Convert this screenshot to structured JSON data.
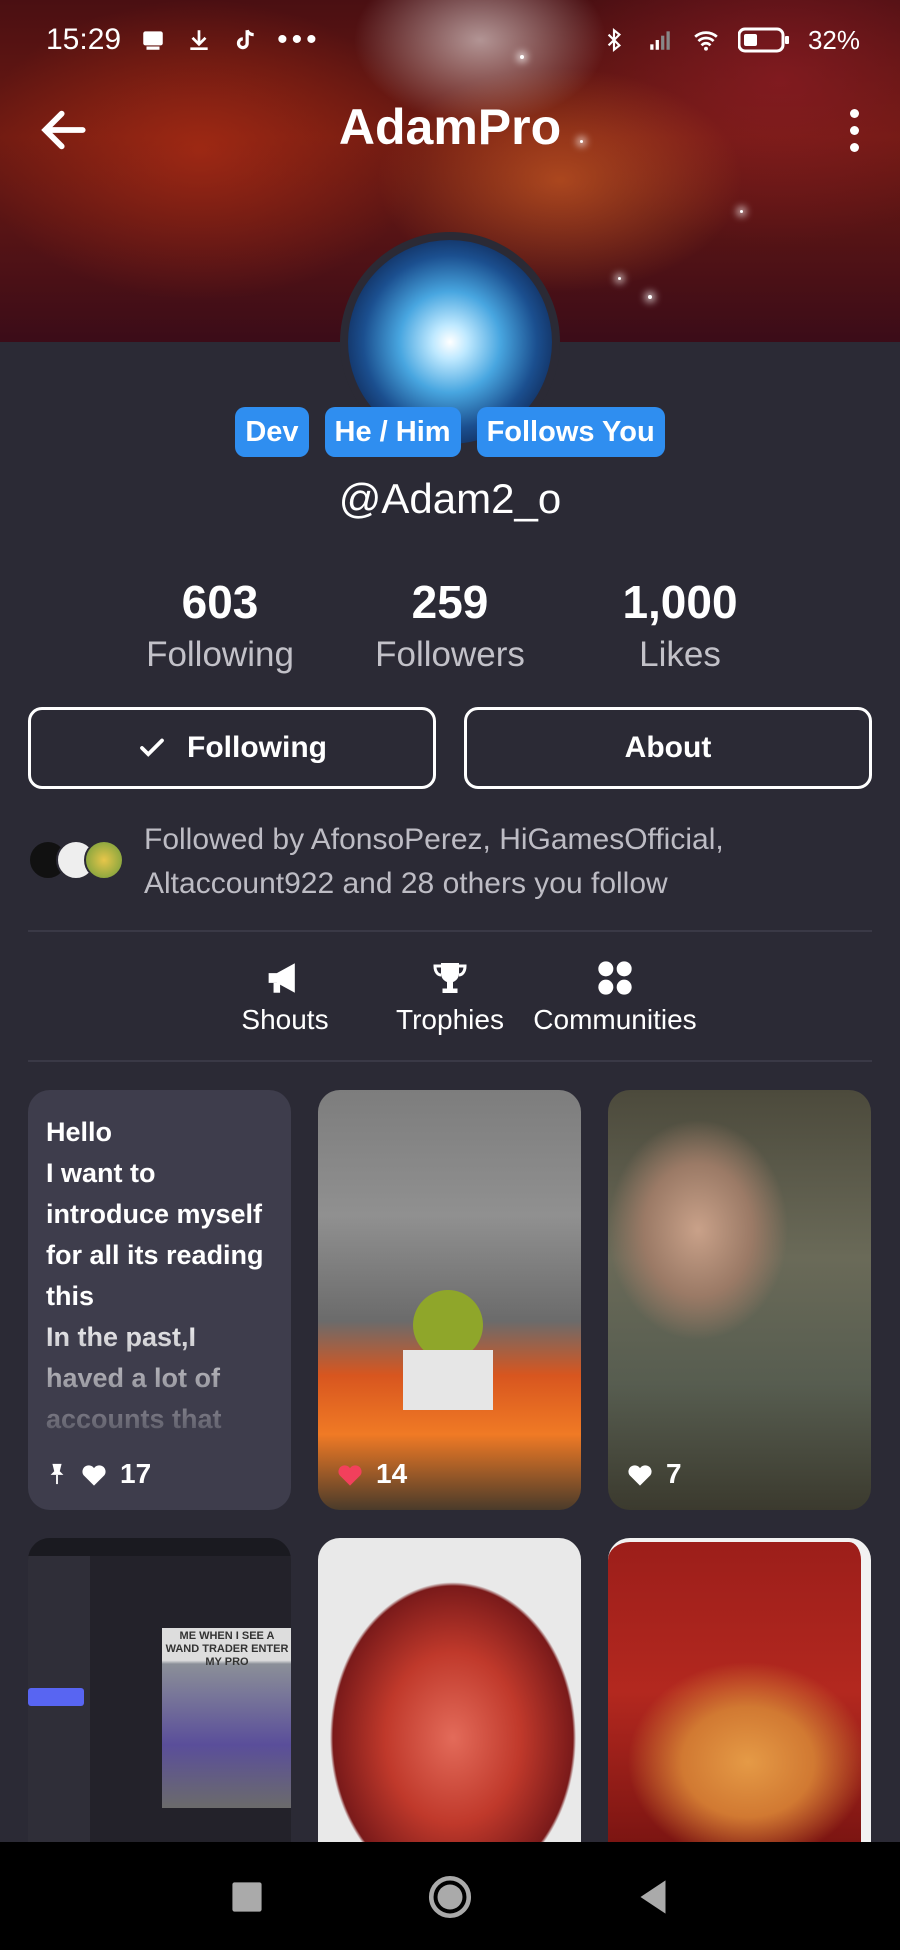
{
  "status_bar": {
    "time": "15:29",
    "battery": "32%"
  },
  "header": {
    "title": "AdamPro",
    "back_icon": "arrow-left-icon",
    "menu_icon": "more-vertical-icon"
  },
  "profile": {
    "badges": [
      "Dev",
      "He / Him",
      "Follows You"
    ],
    "handle": "@Adam2_o",
    "badge_color": "#2f8ef0"
  },
  "stats": [
    {
      "value": "603",
      "label": "Following"
    },
    {
      "value": "259",
      "label": "Followers"
    },
    {
      "value": "1,000",
      "label": "Likes"
    }
  ],
  "actions": {
    "following_label": "Following",
    "about_label": "About"
  },
  "followed_by": {
    "text": "Followed by AfonsoPerez, HiGamesOfficial, Altaccount922 and 28 others you follow"
  },
  "tabs": [
    {
      "label": "Shouts",
      "icon": "megaphone-icon"
    },
    {
      "label": "Trophies",
      "icon": "trophy-icon"
    },
    {
      "label": "Communities",
      "icon": "communities-icon"
    }
  ],
  "posts": [
    {
      "type": "text",
      "text": "Hello\nI want to introduce myself for all its reading this\nIn the past,I haved a lot of accounts that",
      "likes": "17",
      "pinned": true
    },
    {
      "type": "image",
      "likes": "14",
      "liked": true
    },
    {
      "type": "image",
      "likes": "7",
      "liked": false
    },
    {
      "type": "image",
      "caption": "ME WHEN I SEE A WAND TRADER ENTER MY PRO"
    },
    {
      "type": "image"
    },
    {
      "type": "image"
    }
  ]
}
